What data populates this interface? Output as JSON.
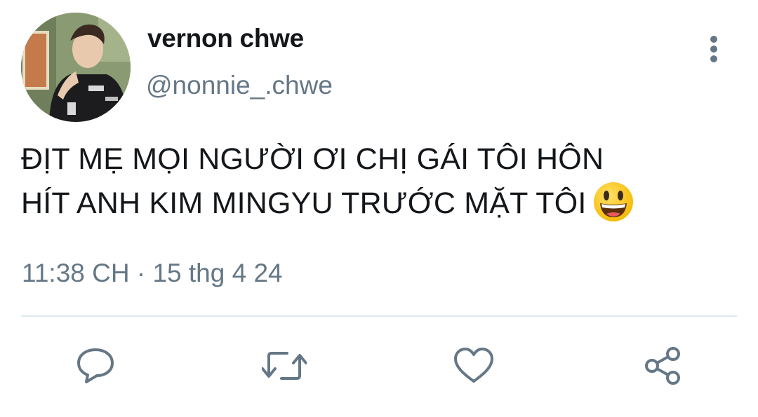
{
  "user": {
    "display_name": "vernon chwe",
    "handle": "@nonnie_.chwe",
    "avatar_icon": "profile-photo"
  },
  "tweet": {
    "line1": "ĐỊT MẸ MỌI NGƯỜI ƠI CHỊ GÁI TÔI HÔN",
    "line2": "HÍT ANH KIM MINGYU TRƯỚC MẶT TÔI",
    "emoji": "grinning-face"
  },
  "meta": {
    "time": "11:38 CH",
    "separator": "·",
    "date": "15 thg 4 24"
  },
  "actions": {
    "reply_icon": "reply-icon",
    "retweet_icon": "retweet-icon",
    "like_icon": "like-icon",
    "share_icon": "share-icon",
    "more_icon": "more-vertical-icon"
  },
  "colors": {
    "text": "#14171a",
    "secondary": "#657786",
    "divider": "#e1e8ed"
  }
}
